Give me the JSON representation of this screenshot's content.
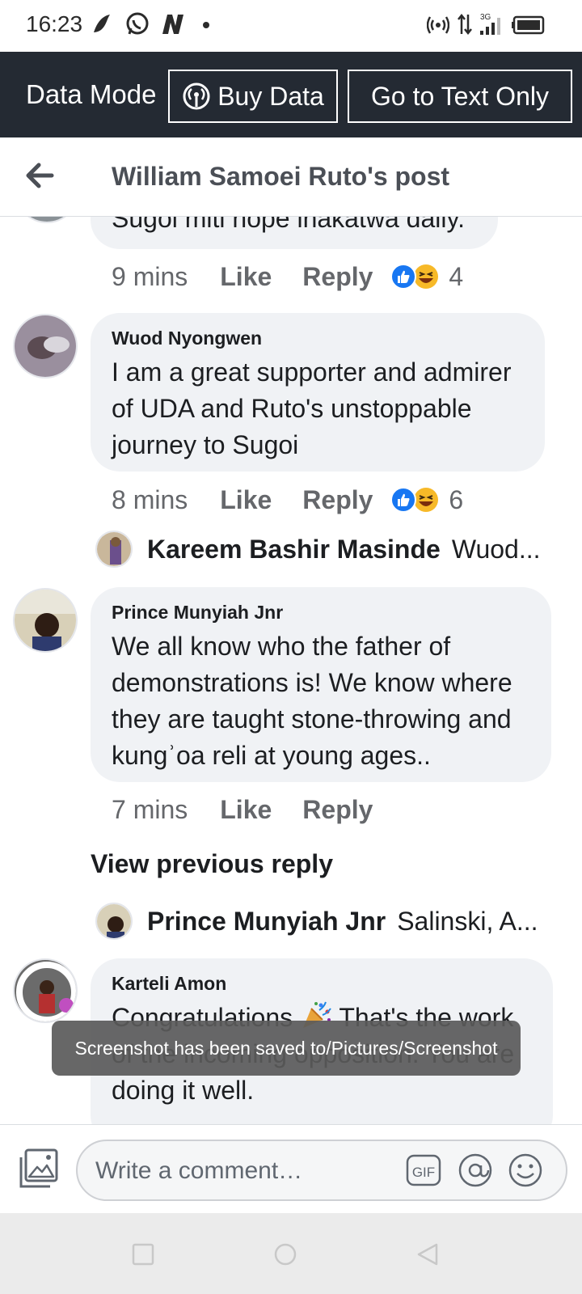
{
  "status_bar": {
    "time": "16:23",
    "left_icons": [
      "bird-app-icon",
      "whatsapp-icon",
      "n-app-icon",
      "dot-icon"
    ],
    "right_icons": [
      "hotspot-icon",
      "data-arrows-icon",
      "signal-3g-icon",
      "battery-icon"
    ],
    "network_type": "3G"
  },
  "data_bar": {
    "mode_label": "Data Mode",
    "buy_label": "Buy Data",
    "text_only_label": "Go to Text Only"
  },
  "header": {
    "title": "William Samoei Ruto's post"
  },
  "comments": [
    {
      "text": "Sugoi miti hope inakatwa daily.",
      "time": "9 mins",
      "like": "Like",
      "reply": "Reply",
      "reaction_count": "4"
    },
    {
      "author": "Wuod Nyongwen",
      "text": "I am a great supporter and admirer of UDA and Ruto's unstoppable journey to Sugoi",
      "time": "8 mins",
      "like": "Like",
      "reply": "Reply",
      "reaction_count": "6",
      "reply_preview": {
        "author": "Kareem Bashir Masinde",
        "snippet": "Wuod..."
      }
    },
    {
      "author": "Prince Munyiah Jnr",
      "text": "We all know who the father of demonstrations is! We know where they are taught stone-throwing and kungʾoa reli at young ages..",
      "time": "7 mins",
      "like": "Like",
      "reply": "Reply",
      "view_previous": "View previous reply",
      "reply_preview": {
        "author": "Prince Munyiah Jnr",
        "snippet": "Salinski, A..."
      }
    },
    {
      "author": "Karteli Amon",
      "text_before": "Congratulations ",
      "text_after": " That's the work of the incoming opposition. You are doing it well."
    }
  ],
  "toast": "Screenshot has been saved to/Pictures/Screenshot",
  "composer": {
    "placeholder": "Write a comment…",
    "gif_label": "GIF"
  },
  "colors": {
    "data_bar_bg": "#242a33",
    "bubble_bg": "#f0f2f5",
    "like_blue": "#1877f2",
    "haha_yellow": "#f7b928"
  }
}
